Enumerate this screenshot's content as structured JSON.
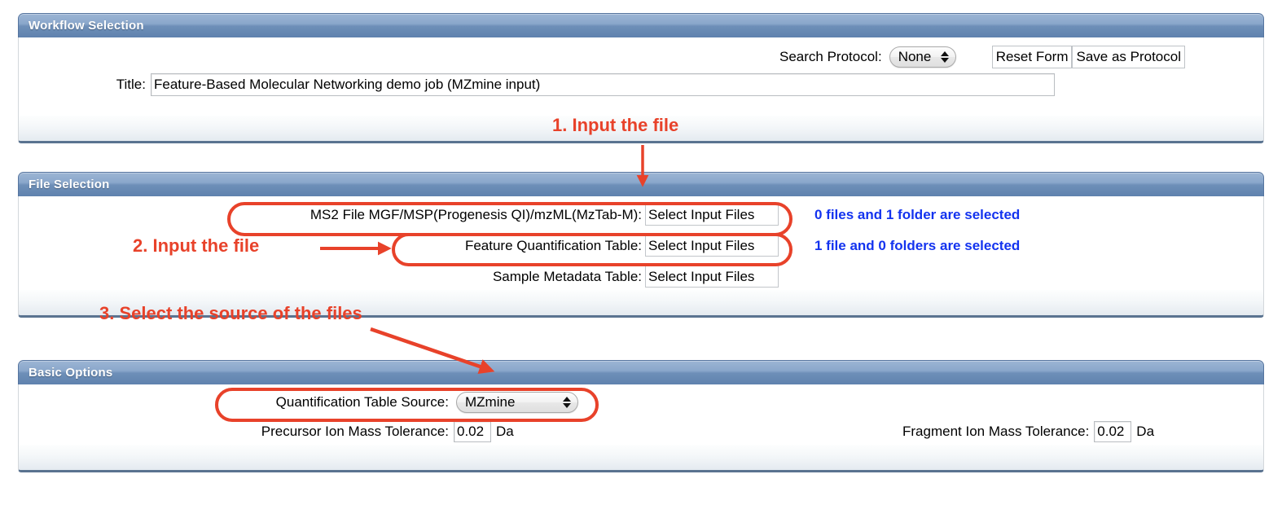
{
  "theme": {
    "header_blue_light": "#9cb5d4",
    "header_blue_dark": "#5f82ae",
    "annotation_red": "#e8422a",
    "status_blue": "#1333ef",
    "panel_border": "#5a7390"
  },
  "sections": {
    "workflow_selection": {
      "title": "Workflow Selection",
      "search_protocol_label": "Search Protocol:",
      "search_protocol_value": "None",
      "search_protocol_options": [
        "None"
      ],
      "reset_form_label": "Reset Form",
      "save_as_protocol_label": "Save as Protocol",
      "title_label": "Title:",
      "title_value": "Feature-Based Molecular Networking demo job (MZmine input)"
    },
    "file_selection": {
      "title": "File Selection",
      "rows": [
        {
          "label": "MS2 File MGF/MSP(Progenesis QI)/mzML(MzTab-M):",
          "button_label": "Select Input Files",
          "status": "0 files and 1 folder are selected"
        },
        {
          "label": "Feature Quantification Table:",
          "button_label": "Select Input Files",
          "status": "1 file and 0 folders are selected"
        },
        {
          "label": "Sample Metadata Table:",
          "button_label": "Select Input Files",
          "status": ""
        }
      ]
    },
    "basic_options": {
      "title": "Basic Options",
      "quant_source_label": "Quantification Table Source:",
      "quant_source_value": "MZmine",
      "quant_source_options": [
        "MZmine"
      ],
      "precursor_label": "Precursor Ion Mass Tolerance:",
      "precursor_value": "0.02",
      "precursor_unit": "Da",
      "fragment_label": "Fragment Ion Mass Tolerance:",
      "fragment_value": "0.02",
      "fragment_unit": "Da"
    }
  },
  "annotations": [
    {
      "id": "step-1",
      "text": "1. Input the file"
    },
    {
      "id": "step-2",
      "text": "2. Input the file"
    },
    {
      "id": "step-3",
      "text": "3. Select the source of the files"
    }
  ]
}
